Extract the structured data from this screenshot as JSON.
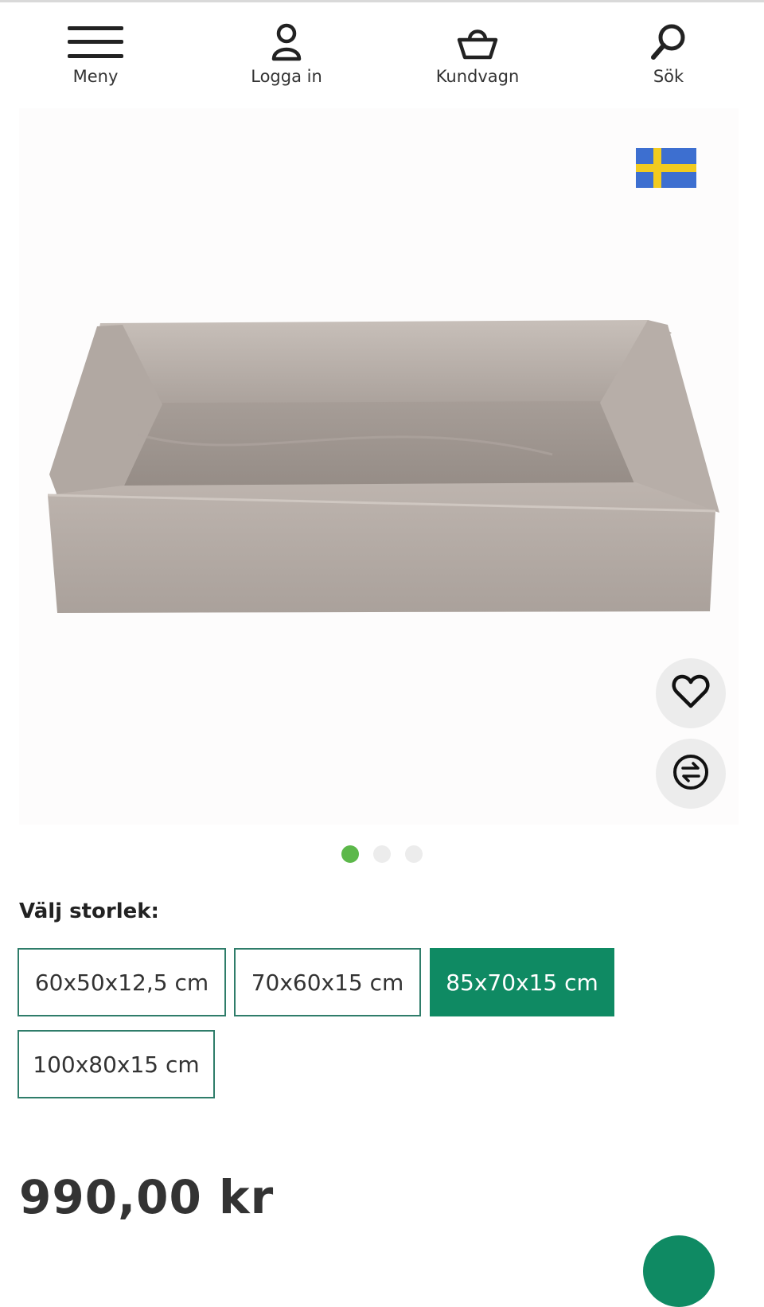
{
  "header": {
    "menu_label": "Meny",
    "login_label": "Logga in",
    "cart_label": "Kundvagn",
    "search_label": "Sök"
  },
  "gallery": {
    "slide_count": 3,
    "active_slide": 1,
    "flag": "swedish-flag-icon"
  },
  "product": {
    "size_heading": "Välj storlek:",
    "sizes": [
      {
        "label": "60x50x12,5 cm",
        "selected": false
      },
      {
        "label": "70x60x15 cm",
        "selected": false
      },
      {
        "label": "85x70x15 cm",
        "selected": true
      },
      {
        "label": "100x80x15 cm",
        "selected": false
      }
    ],
    "price": "990,00 kr"
  },
  "colors": {
    "accent": "#0f8a63",
    "border": "#2f7d6a",
    "active_dot": "#5cb84a",
    "flag_blue": "#3d6fd0",
    "flag_yellow": "#f2cb1f"
  },
  "icons": [
    "menu-icon",
    "user-icon",
    "basket-icon",
    "search-icon",
    "heart-icon",
    "compare-icon"
  ]
}
